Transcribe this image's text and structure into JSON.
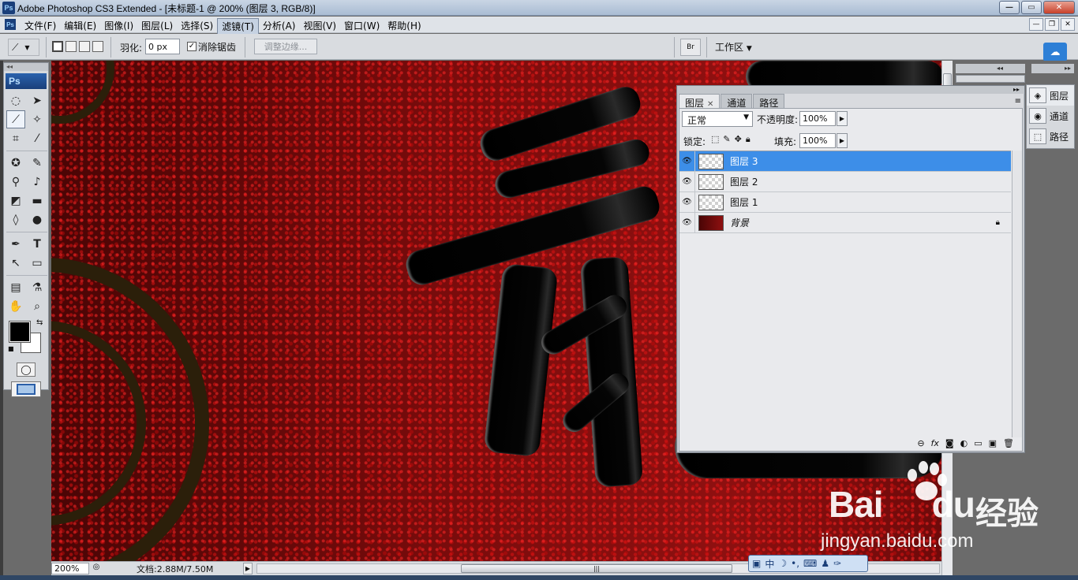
{
  "window": {
    "app_icon": "Ps",
    "title": "Adobe Photoshop CS3 Extended - [未标题-1 @ 200% (图层 3, RGB/8)]",
    "buttons": [
      "minimize",
      "maximize",
      "close"
    ]
  },
  "menubar": {
    "items": [
      "文件(F)",
      "编辑(E)",
      "图像(I)",
      "图层(L)",
      "选择(S)",
      "滤镜(T)",
      "分析(A)",
      "视图(V)",
      "窗口(W)",
      "帮助(H)"
    ],
    "active_index": 5
  },
  "options": {
    "feather_label": "羽化:",
    "feather_value": "0 px",
    "antialias_label": "消除锯齿",
    "antialias_checked": true,
    "refine_edge": "调整边缘...",
    "workspace": "工作区"
  },
  "toolbox": {
    "logo": "Ps",
    "active_tool": "polygonal-lasso",
    "foreground_color": "#000000",
    "background_color": "#ffffff"
  },
  "status": {
    "zoom": "200%",
    "doc_info": "文档:2.88M/7.50M"
  },
  "layers_panel": {
    "tabs": [
      "图层",
      "通道",
      "路径"
    ],
    "active_tab": "图层",
    "blend_mode": "正常",
    "opacity_label": "不透明度:",
    "opacity": "100%",
    "lock_label": "锁定:",
    "fill_label": "填充:",
    "fill": "100%",
    "layers": [
      {
        "name": "图层 3",
        "selected": true
      },
      {
        "name": "图层 2",
        "selected": false
      },
      {
        "name": "图层 1",
        "selected": false
      },
      {
        "name": "背景",
        "selected": false,
        "locked": true
      }
    ]
  },
  "dock": {
    "items": [
      "图层",
      "通道",
      "路径"
    ]
  },
  "ime": {
    "mode": "中"
  },
  "watermark": {
    "brand": "Bai",
    "brand2": "du",
    "cn": "经验",
    "url": "jingyan.baidu.com"
  },
  "colors": {
    "selection": "#3d8ee8",
    "canvas_red": "#8e1010"
  }
}
